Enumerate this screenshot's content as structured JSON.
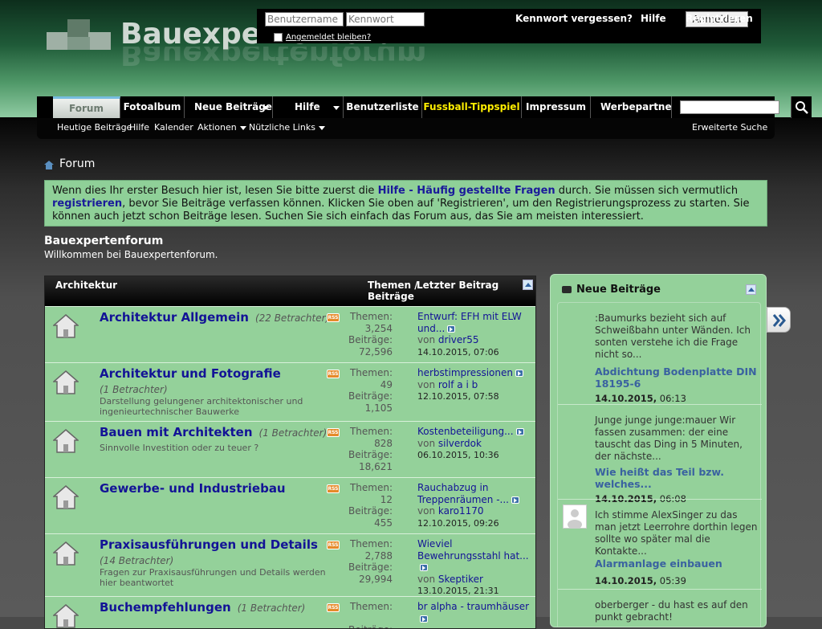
{
  "header": {
    "logo_text": "Bauexpertenforum",
    "login": {
      "username_placeholder": "Benutzername",
      "password_placeholder": "Kennwort",
      "login_button": "Anmelden",
      "forgot_link": "Kennwort vergessen?",
      "help_link": "Hilfe",
      "register_link": "Registrieren",
      "remember_label": "Angemeldet bleiben?"
    }
  },
  "nav": {
    "tabs": [
      "Forum",
      "Fotoalbum",
      "Neue Beiträge",
      "Hilfe",
      "Benutzerliste",
      "Fussball-Tippspiel",
      "Impressum",
      "Werbepartner"
    ],
    "sub": [
      "Heutige Beiträge",
      "Hilfe",
      "Kalender",
      "Aktionen",
      "Nützliche Links"
    ],
    "advanced_search": "Erweiterte Suche"
  },
  "breadcrumb": "Forum",
  "notice": {
    "p1": "Wenn dies Ihr erster Besuch hier ist, lesen Sie bitte zuerst die ",
    "link1": "Hilfe - Häufig gestellte Fragen",
    "p2": " durch. Sie müssen sich vermutlich ",
    "link2": "registrieren",
    "p3": ", bevor Sie Beiträge verfassen können. Klicken Sie oben auf 'Registrieren', um den Registrierungsprozess zu starten. Sie können auch jetzt schon Beiträge lesen. Suchen Sie sich einfach das Forum aus, das Sie am meisten interessiert."
  },
  "forum_title": "Bauexpertenforum",
  "forum_subtitle": "Willkommen bei Bauexpertenforum.",
  "forum_list": {
    "category": "Architektur",
    "col_themes": "Themen /",
    "col_posts": "Beiträge",
    "col_last": "Letzter Beitrag",
    "themes_label": "Themen:",
    "posts_label": "Beiträge:",
    "by_label": "von",
    "rss_label": "RSS",
    "rows": [
      {
        "name": "Architektur Allgemein",
        "viewers": "(22 Betrachter)",
        "desc": "",
        "themes": "3,254",
        "posts": "72,596",
        "last_title": "Entwurf: EFH mit ELW und...",
        "last_user": "driver55",
        "last_date": "14.10.2015, 07:06"
      },
      {
        "name": "Architektur und Fotografie",
        "viewers": "(1 Betrachter)",
        "desc": "Darstellung gelungener architektonischer und ingenieurtechnischer Bauwerke",
        "themes": "49",
        "posts": "1,105",
        "last_title": "herbstimpressionen",
        "last_user": "rolf a i b",
        "last_date": "12.10.2015, 07:58"
      },
      {
        "name": "Bauen mit Architekten",
        "viewers": "(1 Betrachter)",
        "desc": "Sinnvolle Investition oder zu teuer ?",
        "themes": "828",
        "posts": "18,621",
        "last_title": "Kostenbeteiligung...",
        "last_user": "silverdok",
        "last_date": "06.10.2015, 10:36"
      },
      {
        "name": "Gewerbe- und Industriebau",
        "viewers": "",
        "desc": "",
        "themes": "12",
        "posts": "455",
        "last_title": "Rauchabzug in Treppenräumen -...",
        "last_user": "karo1170",
        "last_date": "12.10.2015, 09:26"
      },
      {
        "name": "Praxisausführungen und Details",
        "viewers": "(14 Betrachter)",
        "desc": "Fragen zur Praxisausführungen und Details werden hier beantwortet",
        "themes": "2,788",
        "posts": "29,994",
        "last_title": "Wieviel Bewehrungsstahl hat...",
        "last_user": "Skeptiker",
        "last_date": "13.10.2015, 21:31"
      },
      {
        "name": "Buchempfehlungen",
        "viewers": "(1 Betrachter)",
        "desc": "",
        "themes": "",
        "posts": "",
        "last_title": "br alpha - traumhäuser",
        "last_user": "",
        "last_date": ""
      }
    ]
  },
  "sidebar": {
    "title": "Neue Beiträge",
    "items": [
      {
        "text": ":Baumurks bezieht sich auf Schweißbahn unter Wänden. Ich sonten verstehe ich die Frage nicht so...",
        "title": "Abdichtung Bodenplatte DIN 18195-6",
        "date": "14.10.2015,",
        "time": "06:13",
        "avatar": false
      },
      {
        "text": "Junge junge junge:mauer Wir fassen zusammen: der eine tauscht das Ding in 5 Minuten, der nächste...",
        "title": "Wie heißt das Teil bzw. welches...",
        "date": "14.10.2015,",
        "time": "06:08",
        "avatar": false
      },
      {
        "text": "Ich stimme AlexSinger zu das man jetzt Leerrohre dorthin legen sollte wo später mal die Kontakte...",
        "title": "Alarmanlage einbauen",
        "date": "14.10.2015,",
        "time": "05:39",
        "avatar": true
      },
      {
        "text": "oberberger - du hast es auf den punkt gebracht!",
        "title": "",
        "date": "",
        "time": "",
        "avatar": false
      }
    ]
  },
  "colors": {
    "accent_green": "#94d19a",
    "link_blue": "#131396",
    "tab_yellow": "#ffee00"
  }
}
